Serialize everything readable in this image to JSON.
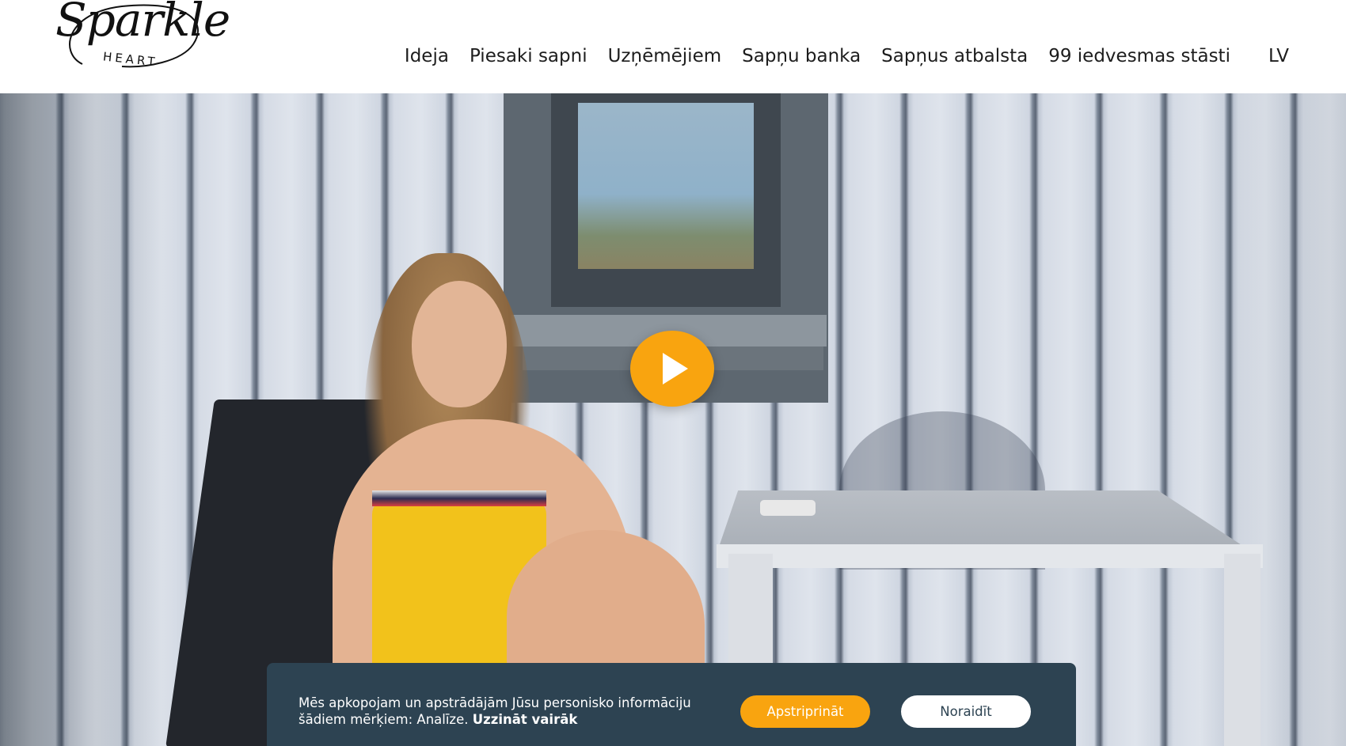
{
  "logo": {
    "script": "Sparkle",
    "sub": "HEART"
  },
  "nav": {
    "items": [
      "Ideja",
      "Piesaki sapni",
      "Uzņēmējiem",
      "Sapņu banka",
      "Sapņus atbalsta",
      "99 iedvesmas stāsti"
    ],
    "language": "LV"
  },
  "hero": {
    "play_icon": "play-icon",
    "accent": "#f9a40f"
  },
  "cookie": {
    "text": "Mēs apkopojam un apstrādājām Jūsu personisko informāciju šādiem mērķiem: Analīze.",
    "link": "Uzzināt vairāk",
    "accept": "Apstriprināt",
    "reject": "Noraidīt",
    "background": "#2d4352"
  }
}
